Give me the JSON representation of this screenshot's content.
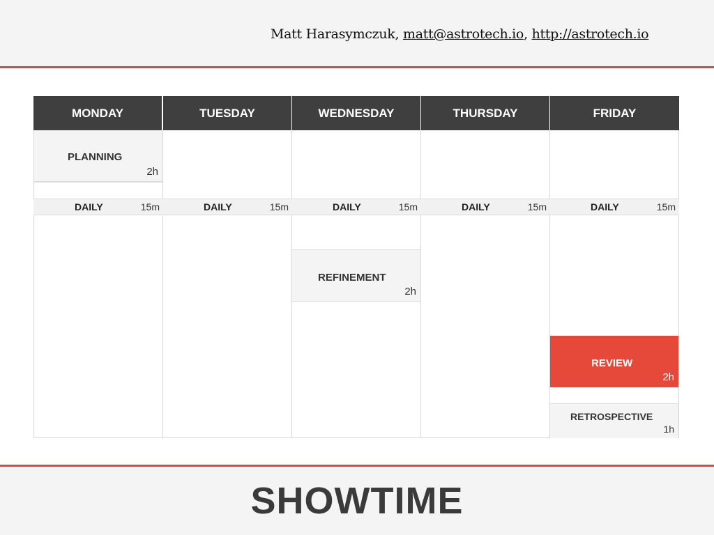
{
  "header": {
    "author_name": "Matt Harasymczuk,",
    "email": "matt@astrotech.io",
    "separator": ",",
    "website": "http://astrotech.io"
  },
  "schedule": {
    "days": [
      "MONDAY",
      "TUESDAY",
      "WEDNESDAY",
      "THURSDAY",
      "FRIDAY"
    ],
    "planning": {
      "title": "PLANNING",
      "duration": "2h"
    },
    "daily": [
      {
        "title": "DAILY",
        "duration": "15m"
      },
      {
        "title": "DAILY",
        "duration": "15m"
      },
      {
        "title": "DAILY",
        "duration": "15m"
      },
      {
        "title": "DAILY",
        "duration": "15m"
      },
      {
        "title": "DAILY",
        "duration": "15m"
      }
    ],
    "refinement": {
      "title": "REFINEMENT",
      "duration": "2h"
    },
    "review": {
      "title": "REVIEW",
      "duration": "2h"
    },
    "retrospective": {
      "title": "RETROSPECTIVE",
      "duration": "1h"
    }
  },
  "footer": {
    "title": "SHOWTIME"
  },
  "colors": {
    "accent": "#e0473a",
    "header_bg": "#3f3f3f",
    "event_bg": "#f4f4f4",
    "review_bg": "#e6483a"
  }
}
